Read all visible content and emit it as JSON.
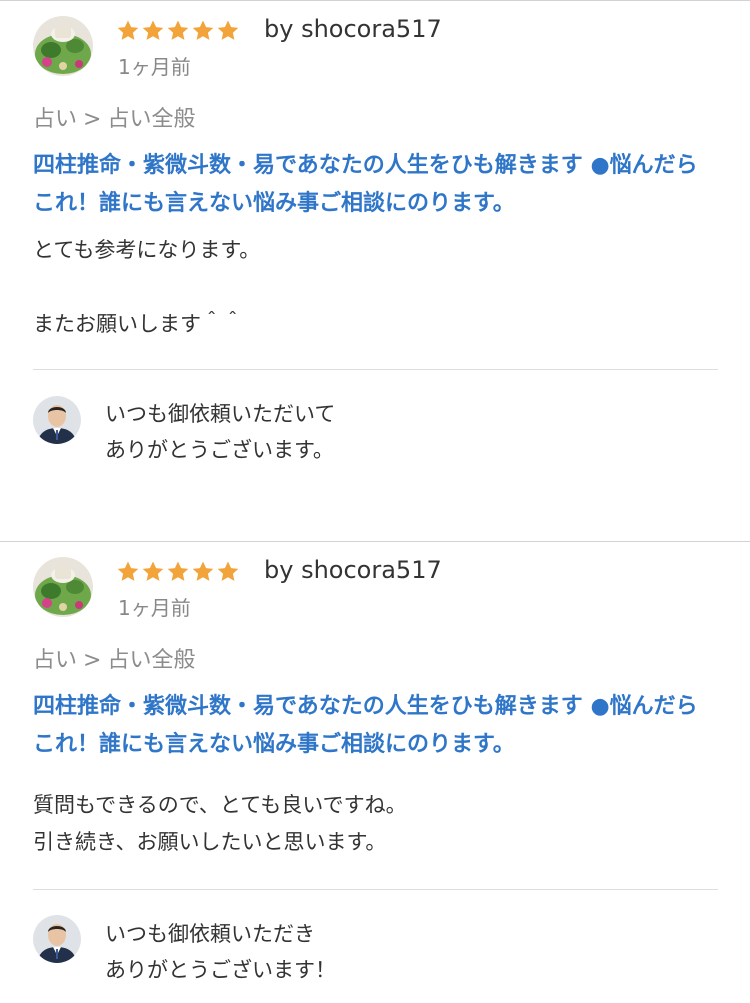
{
  "reviews": [
    {
      "rating": 5,
      "byline": "by shocora517",
      "date": "1ヶ月前",
      "category": "占い",
      "subcategory": "占い全般",
      "breadcrumb_sep": ">",
      "service_title": "四柱推命・紫微斗数・易であなたの人生をひも解きます ●悩んだら これ！誰にも言えない悩み事ご相談にのります。",
      "comment": "とても参考になります。\n\nまたお願いします＾＾",
      "reply": "いつも御依頼いただいて\nありがとうございます。"
    },
    {
      "rating": 5,
      "byline": "by shocora517",
      "date": "1ヶ月前",
      "category": "占い",
      "subcategory": "占い全般",
      "breadcrumb_sep": ">",
      "service_title": "四柱推命・紫微斗数・易であなたの人生をひも解きます ●悩んだら これ！誰にも言えない悩み事ご相談にのります。",
      "comment": "質問もできるので、とても良いですね。\n引き続き、お願いしたいと思います。",
      "reply": "いつも御依頼いただき\nありがとうございます！"
    }
  ],
  "icons": {
    "star": "star-icon",
    "reviewer_avatar": "reviewer-avatar",
    "seller_avatar": "seller-avatar"
  },
  "colors": {
    "star": "#f2a33a",
    "link": "#2f76c9",
    "muted": "#8c8c8c",
    "divider": "#dddddd"
  }
}
